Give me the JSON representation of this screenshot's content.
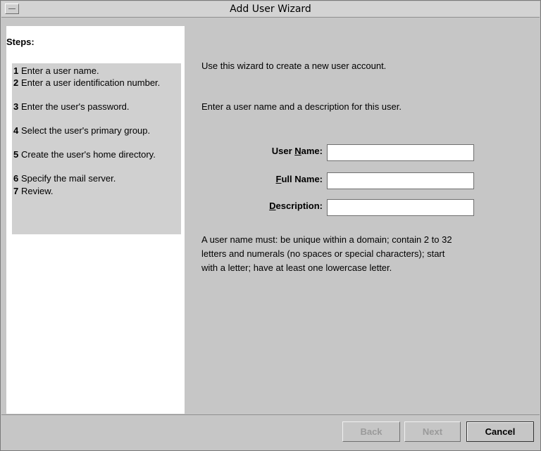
{
  "window": {
    "title": "Add User Wizard"
  },
  "sidebar": {
    "heading": "Steps:",
    "steps": [
      {
        "num": "1",
        "text": "Enter a user name."
      },
      {
        "num": "2",
        "text": "Enter a user identification number."
      },
      {
        "num": "3",
        "text": "Enter the user's password."
      },
      {
        "num": "4",
        "text": "Select the user's primary group."
      },
      {
        "num": "5",
        "text": "Create the user's home directory."
      },
      {
        "num": "6",
        "text": "Specify the mail server."
      },
      {
        "num": "7",
        "text": "Review."
      }
    ]
  },
  "main": {
    "intro": "Use this wizard to create a new user account.",
    "instruction": "Enter a user name and a description for this user.",
    "fields": {
      "user_name": {
        "label_before": "User ",
        "label_mnemonic": "N",
        "label_after": "ame:",
        "value": ""
      },
      "full_name": {
        "label_before": "",
        "label_mnemonic": "F",
        "label_after": "ull Name:",
        "value": ""
      },
      "description": {
        "label_before": "",
        "label_mnemonic": "D",
        "label_after": "escription:",
        "value": ""
      }
    },
    "rules": [
      "A user name must: be unique within a domain; contain 2 to 32",
      "letters and numerals (no spaces or special characters); start",
      "with a letter; have at least one lowercase letter."
    ]
  },
  "footer": {
    "back_label": "Back",
    "next_label": "Next",
    "cancel_label": "Cancel"
  }
}
